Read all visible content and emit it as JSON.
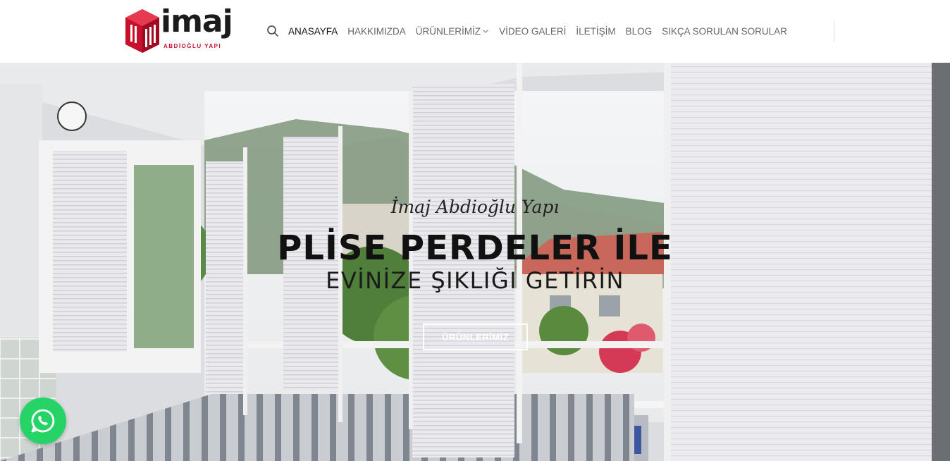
{
  "header": {
    "logo": {
      "name": "imaj",
      "subtitle": "ABDİOĞLU YAPI"
    },
    "search_icon": "search-icon",
    "nav": [
      {
        "label": "ANASAYFA",
        "active": true
      },
      {
        "label": "HAKKIMIZDA",
        "active": false
      },
      {
        "label": "ÜRÜNLERİMİZ",
        "active": false,
        "dropdown": true
      },
      {
        "label": "VİDEO GALERİ",
        "active": false
      },
      {
        "label": "İLETİŞİM",
        "active": false
      },
      {
        "label": "BLOG",
        "active": false
      },
      {
        "label": "SIKÇA SORULAN SORULAR",
        "active": false
      }
    ]
  },
  "hero": {
    "script_text": "İmaj Abdioğlu Yapı",
    "title": "PLİSE PERDELER İLE",
    "subtitle": "EVİNİZE ŞIKLIĞI GETİRİN",
    "button_label": "ÜRÜNLERİMİZ"
  },
  "floating": {
    "whatsapp_icon": "whatsapp-icon"
  },
  "colors": {
    "brand_red": "#c8102e",
    "whatsapp_green": "#25d366",
    "text_dark": "#111111",
    "nav_gray": "#666666"
  }
}
